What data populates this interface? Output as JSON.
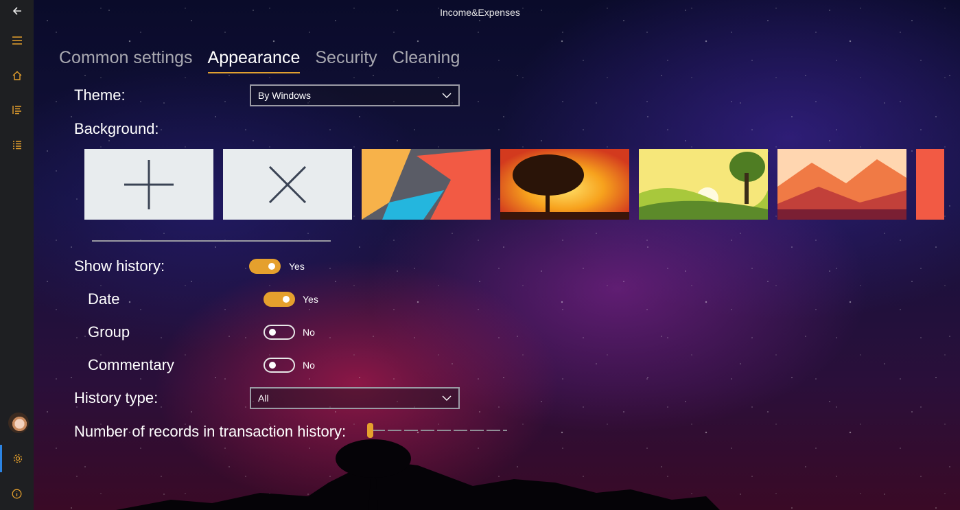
{
  "app": {
    "title": "Income&Expenses"
  },
  "tabs": [
    {
      "label": "Common settings",
      "active": false
    },
    {
      "label": "Appearance",
      "active": true
    },
    {
      "label": "Security",
      "active": false
    },
    {
      "label": "Cleaning",
      "active": false
    }
  ],
  "theme": {
    "label": "Theme:",
    "value": "By Windows"
  },
  "background": {
    "label": "Background:",
    "tiles": [
      "add-icon",
      "remove-icon",
      "abstract-geometric",
      "sunset-tree",
      "green-hills-sunrise",
      "orange-mountains",
      "coral-partial"
    ]
  },
  "history": {
    "show": {
      "label": "Show history:",
      "value": "Yes",
      "on": true
    },
    "date": {
      "label": "Date",
      "value": "Yes",
      "on": true
    },
    "group": {
      "label": "Group",
      "value": "No",
      "on": false
    },
    "commentary": {
      "label": "Commentary",
      "value": "No",
      "on": false
    },
    "type": {
      "label": "History type:",
      "value": "All"
    },
    "records": {
      "label": "Number of records in transaction history:",
      "level": 0
    }
  },
  "sidebar": {
    "icons": [
      "back-arrow-icon",
      "hamburger-menu-icon",
      "home-icon",
      "list-icon",
      "list-icon-2",
      "avatar",
      "gear-icon",
      "info-icon"
    ]
  },
  "colors": {
    "accent": "#e5a02d",
    "sidebar": "#1e1f22",
    "active_indicator": "#2c84e3"
  }
}
